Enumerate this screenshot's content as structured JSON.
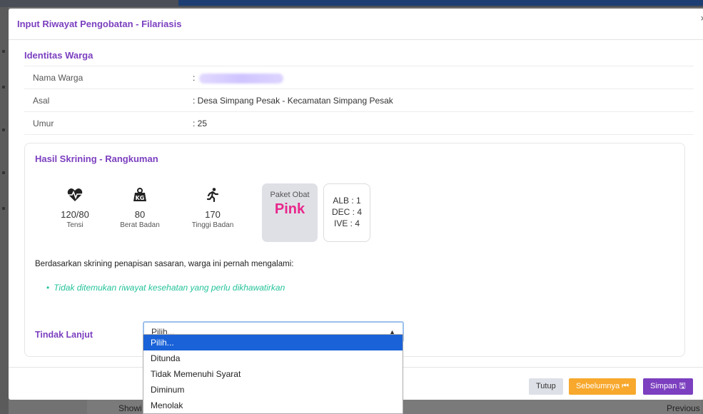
{
  "modal": {
    "title": "Input Riwayat Pengobatan - Filariasis",
    "close": "×"
  },
  "identitas": {
    "title": "Identitas Warga",
    "rows": [
      {
        "label": "Nama Warga",
        "value": ":"
      },
      {
        "label": "Asal",
        "value": ": Desa Simpang Pesak - Kecamatan Simpang Pesak"
      },
      {
        "label": "Umur",
        "value": ": 25"
      }
    ]
  },
  "hasil": {
    "title": "Hasil Skrining - Rangkuman",
    "stats": [
      {
        "value": "120/80",
        "caption": "Tensi",
        "icon": "heartbeat-icon"
      },
      {
        "value": "80",
        "caption": "Berat Badan",
        "icon": "weight-kg-icon"
      },
      {
        "value": "170",
        "caption": "Tinggi Badan",
        "icon": "running-person-icon"
      }
    ],
    "paket_label": "Paket Obat",
    "paket_value": "Pink",
    "dose": [
      "ALB : 1",
      "DEC : 4",
      "IVE : 4"
    ],
    "screening_text": "Berdasarkan skrining penapisan sasaran, warga ini pernah mengalami:",
    "bullets": [
      "Tidak ditemukan riwayat kesehatan yang perlu dikhawatirkan"
    ],
    "tindak_lanjut_label": "Tindak Lanjut",
    "select_value": "Pilih...",
    "options": [
      "Pilih...",
      "Ditunda",
      "Tidak Memenuhi Syarat",
      "Diminum",
      "Menolak"
    ]
  },
  "footer": {
    "tutup": "Tutup",
    "sebelumnya": "Sebelumnya ⏮",
    "simpan": "Simpan 🖫"
  },
  "background": {
    "show_text": "Showi",
    "previous_text": "Previous"
  },
  "colors": {
    "accent": "#7b3fbf",
    "paket_pink": "#e8268b",
    "bullet_green": "#25c39a",
    "selected_option": "#1a62d8",
    "prev_button": "#f7a82d"
  }
}
